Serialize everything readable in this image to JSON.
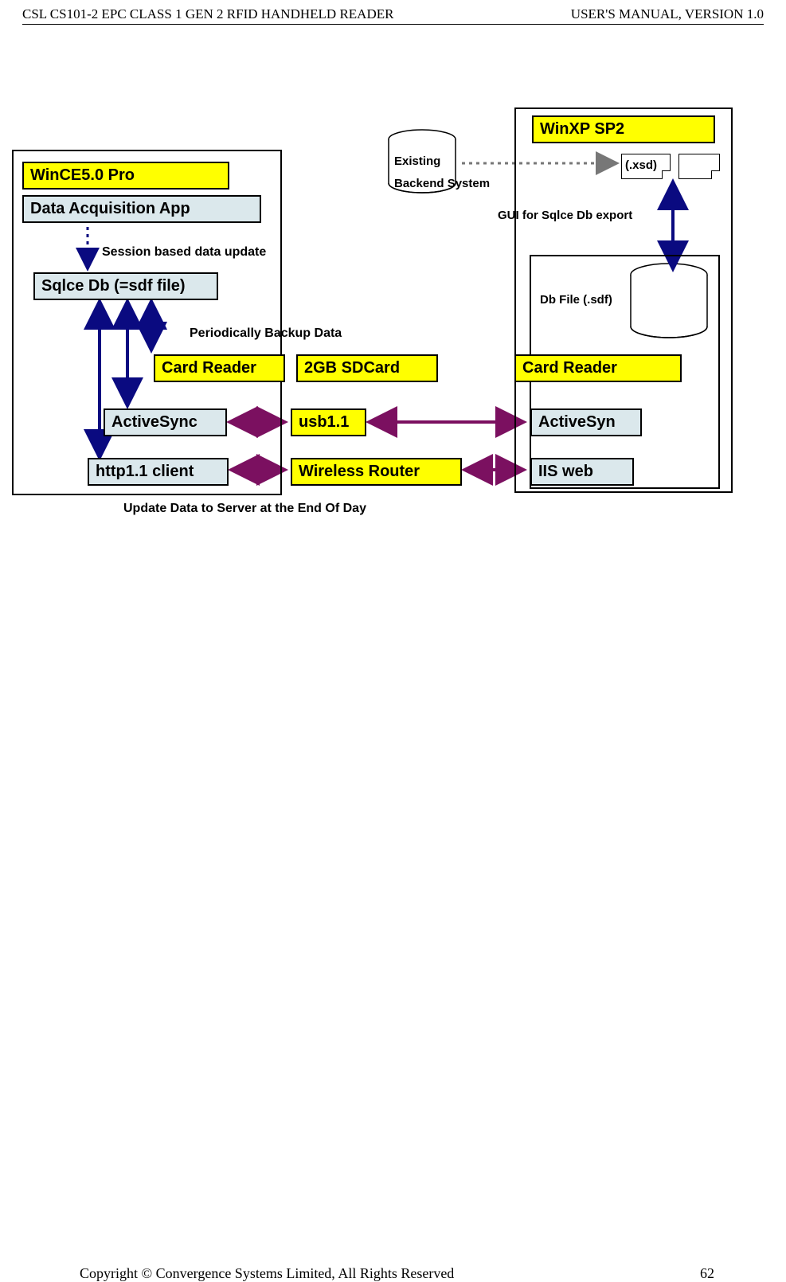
{
  "header": {
    "left": "CSL CS101-2 EPC CLASS 1 GEN 2 RFID HANDHELD READER",
    "right": "USER'S  MANUAL,  VERSION  1.0"
  },
  "footer": {
    "left": "Copyright © Convergence Systems Limited, All Rights Reserved",
    "right": "62"
  },
  "left_device": {
    "os": "WinCE5.0 Pro",
    "app": "Data Acquisition App",
    "db": "Sqlce Db (=sdf file)",
    "card_reader": "Card Reader",
    "activesync": "ActiveSync",
    "http_client": "http1.1 client"
  },
  "middle": {
    "sdcard": "2GB SDCard",
    "usb": "usb1.1",
    "router": "Wireless Router",
    "backend1": "Existing",
    "backend2": "Backend System"
  },
  "right_device": {
    "os": "WinXP SP2",
    "xsd": "(.xsd)",
    "db_file": "Db File (.sdf)",
    "card_reader": "Card Reader",
    "activesync": "ActiveSyn",
    "iis": "IIS web"
  },
  "labels": {
    "session": "Session based data update",
    "backup": "Periodically Backup    Data",
    "gui_export": "GUI  for  Sqlce  Db  export",
    "end_of_day": "Update Data to Server at the End Of Day"
  }
}
